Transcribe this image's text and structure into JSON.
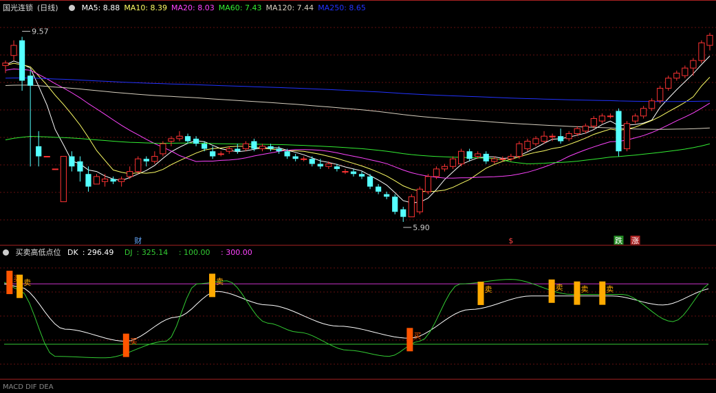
{
  "header": {
    "stock_name": "国光连锁",
    "period": "(日线)",
    "ma": [
      {
        "label": "MA5",
        "value": "8.88",
        "color": "#ffffff"
      },
      {
        "label": "MA10",
        "value": "8.39",
        "color": "#ffff66"
      },
      {
        "label": "MA20",
        "value": "8.03",
        "color": "#ff44ff"
      },
      {
        "label": "MA60",
        "value": "7.43",
        "color": "#33ee33"
      },
      {
        "label": "MA120",
        "value": "7.44",
        "color": "#d8d0c0"
      },
      {
        "label": "MA250",
        "value": "8.65",
        "color": "#2233ff"
      }
    ]
  },
  "indicator": {
    "name": "买卖高低点位",
    "dk_label": "DK",
    "dk_value": "296.49",
    "dj_label": "DJ",
    "dj_value": "325.14",
    "level_mid": "100.00",
    "level_high": "300.00"
  },
  "footer_text": "MACD DIF DEA",
  "chart_data": [
    {
      "type": "candlestick",
      "price_range": [
        5.6,
        10.0
      ],
      "annotations": [
        {
          "label": "9.57",
          "index": 2,
          "kind": "high"
        },
        {
          "label": "5.90",
          "index": 48,
          "kind": "low"
        }
      ],
      "markers": [
        {
          "label": "财",
          "index": 16,
          "color": "#66aaff"
        },
        {
          "label": "$",
          "index": 61,
          "color": "#ff4444"
        },
        {
          "label": "跌",
          "index": 74,
          "color": "#ffffff",
          "bg": "#228822"
        },
        {
          "label": "涨",
          "index": 76,
          "color": "#ffffff",
          "bg": "#aa2222"
        }
      ],
      "candles": [
        [
          9.0,
          9.1,
          8.85,
          9.05
        ],
        [
          9.2,
          9.5,
          9.1,
          9.4
        ],
        [
          9.5,
          9.57,
          8.5,
          8.7
        ],
        [
          8.8,
          8.9,
          7.0,
          8.6
        ],
        [
          7.4,
          7.7,
          7.0,
          7.2
        ],
        [
          7.2,
          7.2,
          7.2,
          7.2
        ],
        [
          6.95,
          6.95,
          6.95,
          6.95
        ],
        [
          6.3,
          7.2,
          6.3,
          7.2
        ],
        [
          7.2,
          7.3,
          6.9,
          7.0
        ],
        [
          7.1,
          7.2,
          6.7,
          6.9
        ],
        [
          6.85,
          7.0,
          6.5,
          6.6
        ],
        [
          6.65,
          6.85,
          6.65,
          6.8
        ],
        [
          6.7,
          6.85,
          6.6,
          6.75
        ],
        [
          6.75,
          6.8,
          6.65,
          6.7
        ],
        [
          6.7,
          6.8,
          6.6,
          6.75
        ],
        [
          6.8,
          7.0,
          6.75,
          6.9
        ],
        [
          6.9,
          7.2,
          6.85,
          7.15
        ],
        [
          7.15,
          7.2,
          7.0,
          7.1
        ],
        [
          7.1,
          7.3,
          7.05,
          7.2
        ],
        [
          7.25,
          7.5,
          7.2,
          7.45
        ],
        [
          7.5,
          7.6,
          7.4,
          7.55
        ],
        [
          7.55,
          7.7,
          7.5,
          7.6
        ],
        [
          7.6,
          7.65,
          7.45,
          7.5
        ],
        [
          7.55,
          7.6,
          7.4,
          7.45
        ],
        [
          7.45,
          7.5,
          7.3,
          7.35
        ],
        [
          7.3,
          7.4,
          7.15,
          7.2
        ],
        [
          7.25,
          7.3,
          7.2,
          7.25
        ],
        [
          7.3,
          7.4,
          7.25,
          7.35
        ],
        [
          7.35,
          7.45,
          7.25,
          7.3
        ],
        [
          7.35,
          7.5,
          7.3,
          7.45
        ],
        [
          7.5,
          7.55,
          7.3,
          7.35
        ],
        [
          7.35,
          7.45,
          7.3,
          7.4
        ],
        [
          7.4,
          7.45,
          7.3,
          7.35
        ],
        [
          7.35,
          7.4,
          7.25,
          7.3
        ],
        [
          7.3,
          7.35,
          7.15,
          7.2
        ],
        [
          7.2,
          7.25,
          7.1,
          7.15
        ],
        [
          7.15,
          7.2,
          7.1,
          7.15
        ],
        [
          7.15,
          7.2,
          7.0,
          7.05
        ],
        [
          7.05,
          7.15,
          6.95,
          7.0
        ],
        [
          7.0,
          7.1,
          6.95,
          7.05
        ],
        [
          7.0,
          7.05,
          6.9,
          6.95
        ],
        [
          6.9,
          6.95,
          6.85,
          6.9
        ],
        [
          6.9,
          6.95,
          6.8,
          6.85
        ],
        [
          6.85,
          6.9,
          6.75,
          6.8
        ],
        [
          6.8,
          6.85,
          6.55,
          6.6
        ],
        [
          6.6,
          6.65,
          6.45,
          6.5
        ],
        [
          6.45,
          6.5,
          6.35,
          6.4
        ],
        [
          6.4,
          6.45,
          6.05,
          6.1
        ],
        [
          6.15,
          6.2,
          5.9,
          6.0
        ],
        [
          6.0,
          6.45,
          6.0,
          6.4
        ],
        [
          6.1,
          6.6,
          6.05,
          6.55
        ],
        [
          6.5,
          6.85,
          6.45,
          6.8
        ],
        [
          6.8,
          7.0,
          6.75,
          6.95
        ],
        [
          6.95,
          7.05,
          6.9,
          7.0
        ],
        [
          7.0,
          7.2,
          6.95,
          7.15
        ],
        [
          7.05,
          7.35,
          7.0,
          7.3
        ],
        [
          7.3,
          7.35,
          7.1,
          7.15
        ],
        [
          7.2,
          7.3,
          7.15,
          7.25
        ],
        [
          7.25,
          7.3,
          7.05,
          7.1
        ],
        [
          7.1,
          7.2,
          7.05,
          7.15
        ],
        [
          7.15,
          7.2,
          7.1,
          7.15
        ],
        [
          7.15,
          7.25,
          7.1,
          7.2
        ],
        [
          7.2,
          7.5,
          7.15,
          7.45
        ],
        [
          7.35,
          7.55,
          7.3,
          7.5
        ],
        [
          7.45,
          7.6,
          7.4,
          7.55
        ],
        [
          7.5,
          7.7,
          7.45,
          7.6
        ],
        [
          7.6,
          7.65,
          7.5,
          7.6
        ],
        [
          7.6,
          7.75,
          7.45,
          7.5
        ],
        [
          7.55,
          7.7,
          7.5,
          7.65
        ],
        [
          7.65,
          7.8,
          7.6,
          7.75
        ],
        [
          7.7,
          7.85,
          7.65,
          7.8
        ],
        [
          7.8,
          8.0,
          7.75,
          7.95
        ],
        [
          7.9,
          8.05,
          7.85,
          8.0
        ],
        [
          8.0,
          8.05,
          7.95,
          8.0
        ],
        [
          8.1,
          8.15,
          7.2,
          7.3
        ],
        [
          7.35,
          7.9,
          7.3,
          7.85
        ],
        [
          7.9,
          8.05,
          7.85,
          8.0
        ],
        [
          8.0,
          8.2,
          7.95,
          8.15
        ],
        [
          8.15,
          8.35,
          8.1,
          8.3
        ],
        [
          8.3,
          8.6,
          8.25,
          8.55
        ],
        [
          8.55,
          8.8,
          8.5,
          8.75
        ],
        [
          8.75,
          8.9,
          8.7,
          8.85
        ],
        [
          8.8,
          9.0,
          8.75,
          8.95
        ],
        [
          8.95,
          9.15,
          8.8,
          9.1
        ],
        [
          9.1,
          9.5,
          9.05,
          9.45
        ],
        [
          9.4,
          9.65,
          9.3,
          9.6
        ]
      ]
    },
    {
      "type": "line",
      "levels": [
        100,
        300
      ],
      "series": [
        {
          "name": "DK",
          "color": "#ffffff"
        },
        {
          "name": "DJ",
          "color": "#33cc33"
        }
      ],
      "signals": [
        {
          "label": "买",
          "index": 1,
          "color": "#ff5500"
        },
        {
          "label": "卖",
          "index": 3,
          "color": "#ffaa00"
        },
        {
          "label": "买",
          "index": 24,
          "color": "#ff5500"
        },
        {
          "label": "卖",
          "index": 41,
          "color": "#ffaa00"
        },
        {
          "label": "买",
          "index": 80,
          "color": "#ff5500"
        },
        {
          "label": "卖",
          "index": 94,
          "color": "#ffaa00"
        },
        {
          "label": "卖",
          "index": 108,
          "color": "#ffaa00"
        },
        {
          "label": "卖",
          "index": 113,
          "color": "#ffaa00"
        },
        {
          "label": "卖",
          "index": 118,
          "color": "#ffaa00"
        }
      ]
    }
  ]
}
